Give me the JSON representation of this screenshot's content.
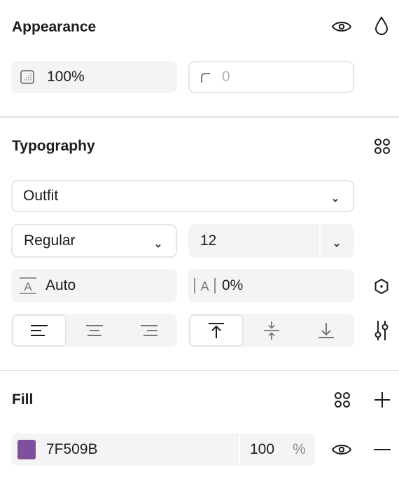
{
  "appearance": {
    "title": "Appearance",
    "opacity_value": "100%",
    "radius_value": "0",
    "icons": [
      "eye-icon",
      "drop-icon",
      "opacity-icon",
      "corner-radius-icon"
    ]
  },
  "typography": {
    "title": "Typography",
    "font_family": "Outfit",
    "font_weight": "Regular",
    "font_size": "12",
    "line_height": "Auto",
    "letter_spacing": "0%",
    "text_align_options": [
      "left",
      "center",
      "right"
    ],
    "text_align_selected": "left",
    "vertical_align_options": [
      "top",
      "middle",
      "bottom"
    ],
    "vertical_align_selected": "top"
  },
  "fill": {
    "title": "Fill",
    "color_hex": "7F509B",
    "color_swatch": "#7F509B",
    "opacity": "100",
    "opacity_unit": "%"
  }
}
